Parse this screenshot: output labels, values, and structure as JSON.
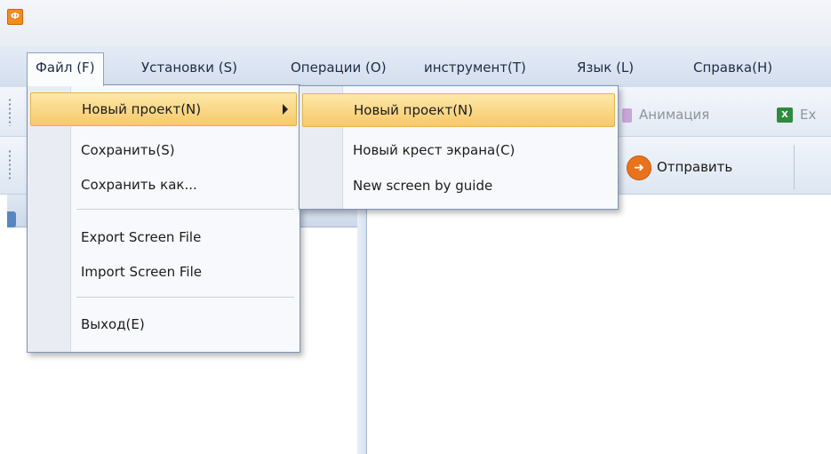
{
  "app_icon_glyph": "Ф",
  "menubar": {
    "items": [
      {
        "label": "Файл (F)"
      },
      {
        "label": "Установки (S)"
      },
      {
        "label": "Операции (O)"
      },
      {
        "label": "инструмент(T)"
      },
      {
        "label": "Язык (L)"
      },
      {
        "label": "Справка(H)"
      }
    ]
  },
  "toolbar": {
    "animation_label": "Анимация",
    "excel_label": "Ex",
    "excel_glyph": "X",
    "send_label": "Отправить",
    "send_glyph": "➜"
  },
  "file_menu": {
    "items": [
      {
        "label": "Новый проект(N)"
      },
      {
        "label": "Сохранить(S)"
      },
      {
        "label": "Сохранить как..."
      },
      {
        "label": "Export Screen File"
      },
      {
        "label": "Import Screen File"
      },
      {
        "label": "Выход(E)"
      }
    ]
  },
  "new_project_submenu": {
    "items": [
      {
        "label": "Новый проект(N)"
      },
      {
        "label": "Новый крест экрана(C)"
      },
      {
        "label": "New screen by guide"
      }
    ]
  },
  "pane_icon_glyph": "ዷ",
  "colors": {
    "highlight": "#f7c96a",
    "menubar": "#d3deee",
    "send_icon": "#e8731c"
  }
}
